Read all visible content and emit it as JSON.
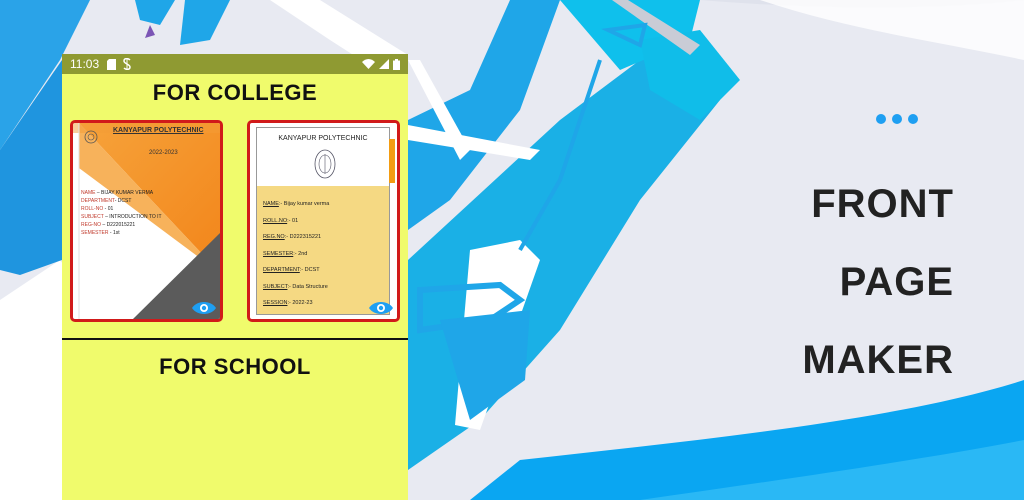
{
  "status": {
    "time": "11:03",
    "sim_icon": "sd-card-icon",
    "data_icon": "s-icon",
    "wifi_icon": "wifi-icon",
    "signal_icon": "signal-icon",
    "battery_icon": "battery-icon"
  },
  "college": {
    "title": "FOR COLLEGE",
    "card1": {
      "institution": "KANYAPUR POLYTECHNIC",
      "year": "2022-2023",
      "lines": [
        {
          "key": "NAME",
          "sep": " – ",
          "value": "BIJAY KUMAR VERMA"
        },
        {
          "key": "DEPARTMENT",
          "sep": "- ",
          "value": "DCST"
        },
        {
          "key": "ROLL-NO",
          "sep": " - ",
          "value": "01"
        },
        {
          "key": "SUBJECT",
          "sep": " – ",
          "value": "INTRODUCTION TO IT"
        },
        {
          "key": "REG-NO",
          "sep": " – ",
          "value": "D222015221"
        },
        {
          "key": "SEMESTER",
          "sep": " - ",
          "value": "1st"
        }
      ]
    },
    "card2": {
      "institution": "KANYAPUR POLYTECHNIC",
      "lines": [
        {
          "key": "NAME",
          "sep": ":- ",
          "value": "Bijay kumar verma"
        },
        {
          "key": "ROLL.NO",
          "sep": ":- ",
          "value": "01"
        },
        {
          "key": "REG.NO",
          "sep": ":- ",
          "value": "D222315221"
        },
        {
          "key": "SEMESTER",
          "sep": ":- ",
          "value": "2nd"
        },
        {
          "key": "DEPARTMENT",
          "sep": ":- ",
          "value": "DCST"
        },
        {
          "key": "SUBJECT",
          "sep": ":- ",
          "value": "Data Structure"
        },
        {
          "key": "SESSION",
          "sep": ":- ",
          "value": "2022-23"
        }
      ]
    },
    "preview_icon": "eye-icon"
  },
  "school": {
    "title": "FOR SCHOOL"
  },
  "promo": {
    "menu_icon": "more-dots-icon",
    "title_lines": [
      "FRONT",
      "PAGE",
      "MAKER"
    ]
  },
  "colors": {
    "phone_bg": "#f0fb6c",
    "status_bg": "#8f9a32",
    "card_border": "#d11a1a",
    "accent_blue": "#1e9ff2",
    "orange": "#f7931e"
  }
}
